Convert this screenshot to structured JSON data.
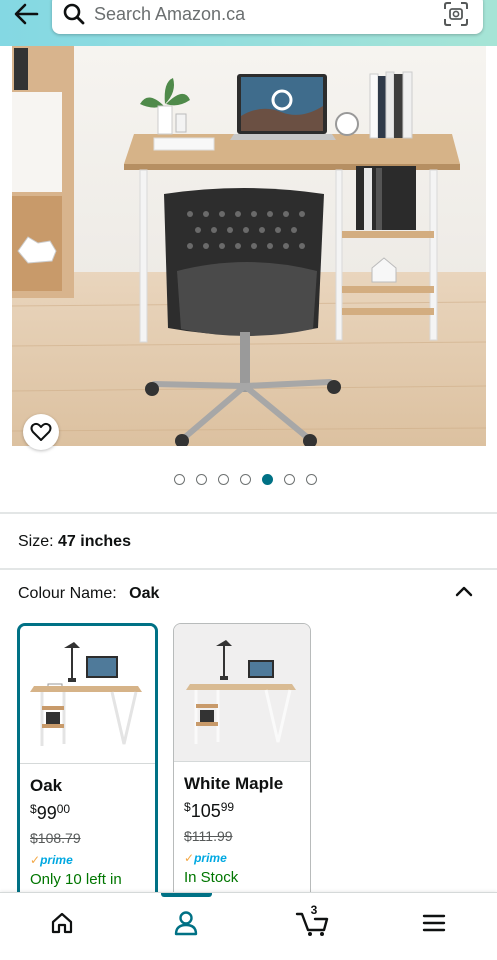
{
  "search": {
    "placeholder": "Search Amazon.ca"
  },
  "gallery": {
    "total_images": 7,
    "active_index": 4
  },
  "size": {
    "label": "Size:",
    "value": "47 inches"
  },
  "colour": {
    "label": "Colour Name:",
    "value": "Oak"
  },
  "swatches": [
    {
      "name": "Oak",
      "currency": "$",
      "price_whole": "99",
      "price_cents": "00",
      "list_price": "$108.79",
      "prime": "prime",
      "availability": "Only 10 left in"
    },
    {
      "name": "White Maple",
      "currency": "$",
      "price_whole": "105",
      "price_cents": "99",
      "list_price": "$111.99",
      "prime": "prime",
      "availability": "In Stock"
    }
  ],
  "cart": {
    "count": "3"
  },
  "colors": {
    "accent": "#007185",
    "header_start": "#84d8e3",
    "header_end": "#a6e4d6",
    "prime": "#00a8e1",
    "in_stock": "#007600"
  },
  "icons": {
    "back": "arrow-left-icon",
    "search": "search-icon",
    "camera": "camera-scan-icon",
    "wishlist": "heart-icon",
    "collapse": "chevron-up-icon",
    "home": "home-icon",
    "account": "user-icon",
    "cart": "cart-icon",
    "menu": "menu-icon"
  }
}
